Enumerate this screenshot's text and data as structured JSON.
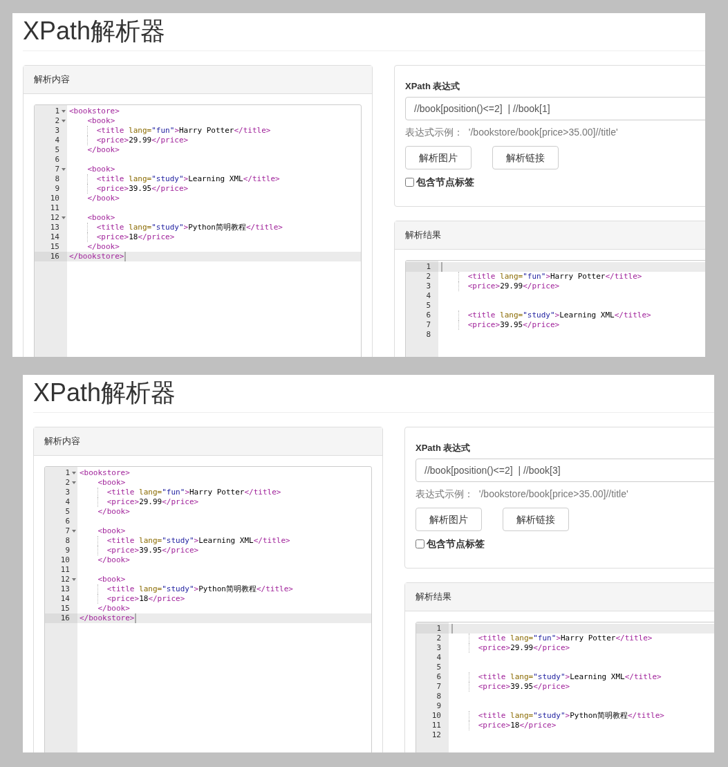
{
  "screenshots": [
    {
      "title": "XPath解析器",
      "source_panel": {
        "title": "解析内容",
        "lines": [
          {
            "number": "1",
            "text": "<bookstore>",
            "foldable": true,
            "active": false
          },
          {
            "number": "2",
            "text": "    <book>",
            "foldable": true,
            "active": false
          },
          {
            "number": "3",
            "text": "      <title lang=\"fun\">Harry Potter</title>",
            "foldable": false,
            "active": false
          },
          {
            "number": "4",
            "text": "      <price>29.99</price>",
            "foldable": false,
            "active": false
          },
          {
            "number": "5",
            "text": "    </book>",
            "foldable": false,
            "active": false
          },
          {
            "number": "6",
            "foldable": false,
            "active": false
          },
          {
            "number": "7",
            "text": "    <book>",
            "foldable": true,
            "active": false
          },
          {
            "number": "8",
            "text": "      <title lang=\"study\">Learning XML</title>",
            "foldable": false,
            "active": false
          },
          {
            "number": "9",
            "text": "      <price>39.95</price>",
            "foldable": false,
            "active": false
          },
          {
            "number": "10",
            "text": "    </book>",
            "foldable": false,
            "active": false
          },
          {
            "number": "11",
            "foldable": false,
            "active": false
          },
          {
            "number": "12",
            "text": "    <book>",
            "foldable": true,
            "active": false
          },
          {
            "number": "13",
            "text": "      <title lang=\"study\">Python简明教程</title>",
            "foldable": false,
            "active": false
          },
          {
            "number": "14",
            "text": "      <price>18</price>",
            "foldable": false,
            "active": false
          },
          {
            "number": "15",
            "text": "    </book>",
            "foldable": false,
            "active": false
          },
          {
            "number": "16",
            "text": "</bookstore>",
            "foldable": false,
            "active": true
          }
        ]
      },
      "query_panel": {
        "label": "XPath 表达式",
        "expression": "//book[position()<=2]  | //book[1]",
        "example": "表达式示例：  '/bookstore/book[price>35.00]//title'",
        "buttons": [
          "解析图片",
          "解析链接"
        ],
        "checkbox": {
          "label": "包含节点标签",
          "checked": false
        }
      },
      "result_panel": {
        "title": "解析结果",
        "lines": [
          {
            "number": "1",
            "foldable": false,
            "active": true
          },
          {
            "number": "2",
            "text": "      <title lang=\"fun\">Harry Potter</title>",
            "foldable": false,
            "active": false
          },
          {
            "number": "3",
            "text": "      <price>29.99</price>",
            "foldable": false,
            "active": false
          },
          {
            "number": "4",
            "foldable": false,
            "active": false
          },
          {
            "number": "5",
            "foldable": false,
            "active": false
          },
          {
            "number": "6",
            "text": "      <title lang=\"study\">Learning XML</title>",
            "foldable": false,
            "active": false
          },
          {
            "number": "7",
            "text": "      <price>39.95</price>",
            "foldable": false,
            "active": false
          },
          {
            "number": "8",
            "foldable": false,
            "active": false
          }
        ]
      }
    },
    {
      "title": "XPath解析器",
      "source_panel": {
        "title": "解析内容",
        "lines": [
          {
            "number": "1",
            "text": "<bookstore>",
            "foldable": true,
            "active": false
          },
          {
            "number": "2",
            "text": "    <book>",
            "foldable": true,
            "active": false
          },
          {
            "number": "3",
            "text": "      <title lang=\"fun\">Harry Potter</title>",
            "foldable": false,
            "active": false
          },
          {
            "number": "4",
            "text": "      <price>29.99</price>",
            "foldable": false,
            "active": false
          },
          {
            "number": "5",
            "text": "    </book>",
            "foldable": false,
            "active": false
          },
          {
            "number": "6",
            "foldable": false,
            "active": false
          },
          {
            "number": "7",
            "text": "    <book>",
            "foldable": true,
            "active": false
          },
          {
            "number": "8",
            "text": "      <title lang=\"study\">Learning XML</title>",
            "foldable": false,
            "active": false
          },
          {
            "number": "9",
            "text": "      <price>39.95</price>",
            "foldable": false,
            "active": false
          },
          {
            "number": "10",
            "text": "    </book>",
            "foldable": false,
            "active": false
          },
          {
            "number": "11",
            "foldable": false,
            "active": false
          },
          {
            "number": "12",
            "text": "    <book>",
            "foldable": true,
            "active": false
          },
          {
            "number": "13",
            "text": "      <title lang=\"study\">Python简明教程</title>",
            "foldable": false,
            "active": false
          },
          {
            "number": "14",
            "text": "      <price>18</price>",
            "foldable": false,
            "active": false
          },
          {
            "number": "15",
            "text": "    </book>",
            "foldable": false,
            "active": false
          },
          {
            "number": "16",
            "text": "</bookstore>",
            "foldable": false,
            "active": true
          }
        ]
      },
      "query_panel": {
        "label": "XPath 表达式",
        "expression": "//book[position()<=2]  | //book[3]",
        "example": "表达式示例：  '/bookstore/book[price>35.00]//title'",
        "buttons": [
          "解析图片",
          "解析链接"
        ],
        "checkbox": {
          "label": "包含节点标签",
          "checked": false
        }
      },
      "result_panel": {
        "title": "解析结果",
        "lines": [
          {
            "number": "1",
            "foldable": false,
            "active": true
          },
          {
            "number": "2",
            "text": "      <title lang=\"fun\">Harry Potter</title>",
            "foldable": false,
            "active": false
          },
          {
            "number": "3",
            "text": "      <price>29.99</price>",
            "foldable": false,
            "active": false
          },
          {
            "number": "4",
            "foldable": false,
            "active": false
          },
          {
            "number": "5",
            "foldable": false,
            "active": false
          },
          {
            "number": "6",
            "text": "      <title lang=\"study\">Learning XML</title>",
            "foldable": false,
            "active": false
          },
          {
            "number": "7",
            "text": "      <price>39.95</price>",
            "foldable": false,
            "active": false
          },
          {
            "number": "8",
            "foldable": false,
            "active": false
          },
          {
            "number": "9",
            "foldable": false,
            "active": false
          },
          {
            "number": "10",
            "text": "      <title lang=\"study\">Python简明教程</title>",
            "foldable": false,
            "active": false
          },
          {
            "number": "11",
            "text": "      <price>18</price>",
            "foldable": false,
            "active": false
          },
          {
            "number": "12",
            "foldable": false,
            "active": false
          }
        ]
      }
    }
  ]
}
